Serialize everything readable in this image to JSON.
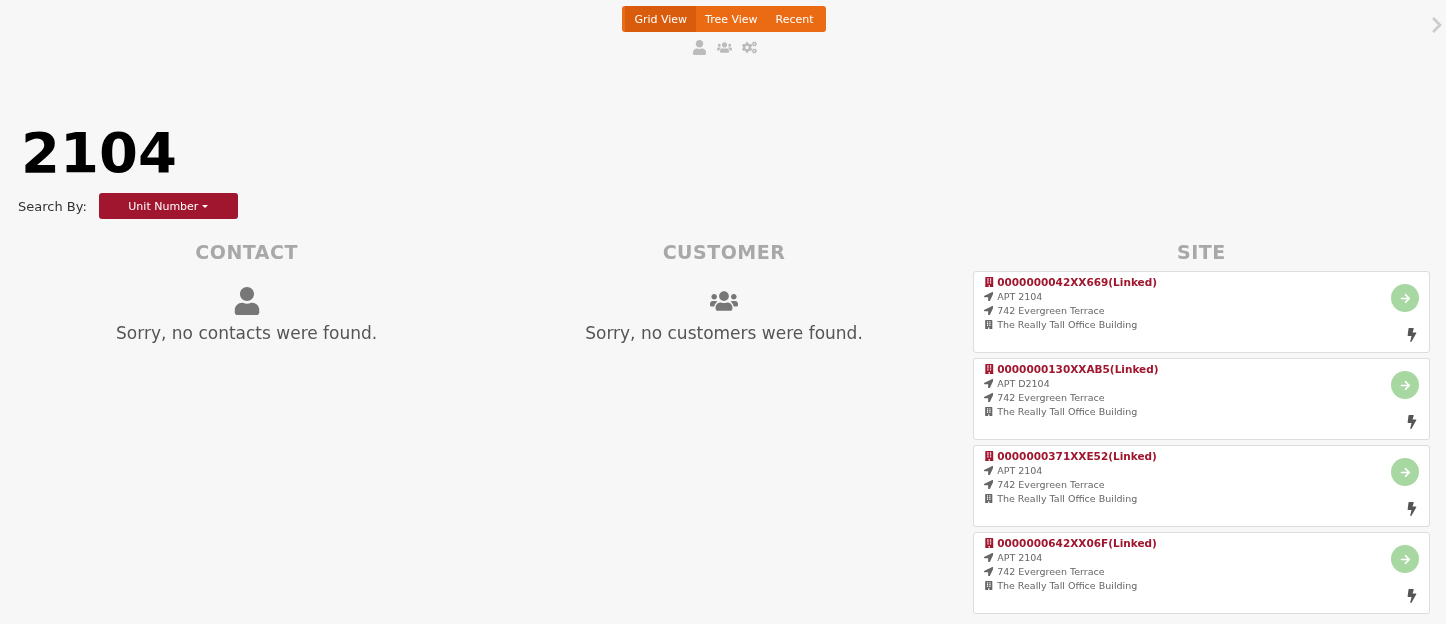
{
  "view_tabs": [
    {
      "label": "Grid View",
      "selected": true
    },
    {
      "label": "Tree View",
      "selected": false
    },
    {
      "label": "Recent",
      "selected": false
    }
  ],
  "query": "2104",
  "search_by": {
    "label": "Search By:",
    "value": "Unit Number"
  },
  "contact": {
    "heading": "CONTACT",
    "empty_message": "Sorry, no contacts were found."
  },
  "customer": {
    "heading": "CUSTOMER",
    "empty_message": "Sorry, no customers were found."
  },
  "site": {
    "heading": "SITE",
    "cards": [
      {
        "title": "0000000042XX669(Linked)",
        "unit": "APT 2104",
        "address": "742 Evergreen Terrace",
        "building": "The Really Tall Office Building"
      },
      {
        "title": "0000000130XXAB5(Linked)",
        "unit": "APT D2104",
        "address": "742 Evergreen Terrace",
        "building": "The Really Tall Office Building"
      },
      {
        "title": "0000000371XXE52(Linked)",
        "unit": "APT 2104",
        "address": "742 Evergreen Terrace",
        "building": "The Really Tall Office Building"
      },
      {
        "title": "0000000642XX06F(Linked)",
        "unit": "APT 2104",
        "address": "742 Evergreen Terrace",
        "building": "The Really Tall Office Building"
      }
    ]
  }
}
